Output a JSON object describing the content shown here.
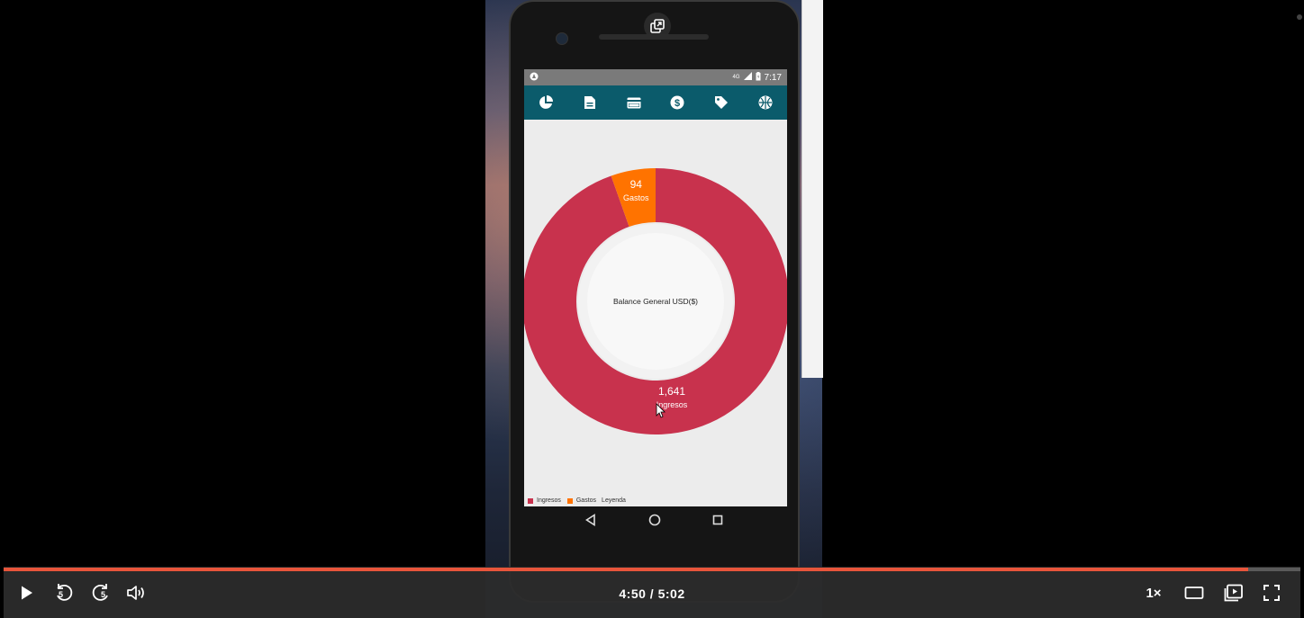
{
  "phone": {
    "status_time": "7:17",
    "status_network": "4G",
    "toolbar_icons": [
      "pie-chart-icon",
      "document-icon",
      "credit-card-icon",
      "dollar-icon",
      "tag-icon",
      "sports-icon"
    ]
  },
  "chart_data": {
    "type": "pie",
    "subtype": "donut",
    "center_text": "Balance General USD($)",
    "slices": [
      {
        "label": "Ingresos",
        "value": 1641,
        "display": "1,641",
        "color": "#c8324d"
      },
      {
        "label": "Gastos",
        "value": 94,
        "display": "94",
        "color": "#ff7300"
      }
    ],
    "legend": [
      "Ingresos",
      "Gastos",
      "Leyenda"
    ],
    "legend_placement": "bottom-left"
  },
  "player": {
    "time_display": "4:50 / 5:02",
    "progress": 0.96,
    "buffered": 0.96,
    "speed": "1×",
    "rewind_seconds": "5",
    "forward_seconds": "5",
    "accent_color": "#e8553b"
  }
}
